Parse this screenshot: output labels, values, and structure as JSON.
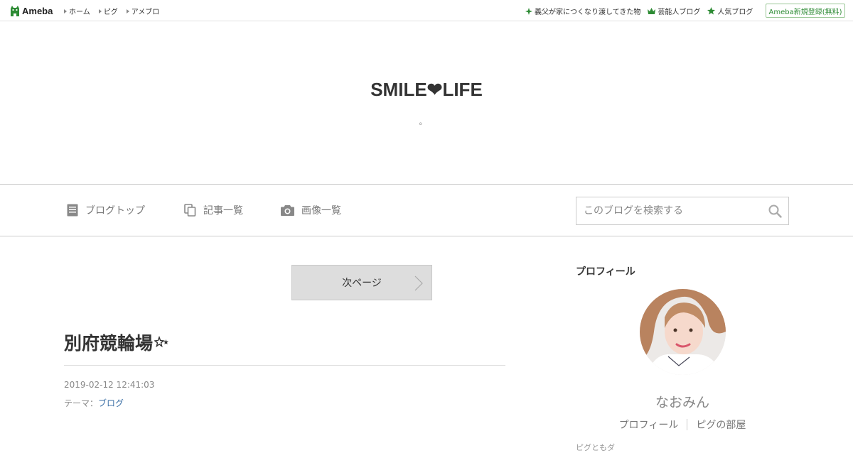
{
  "topbar": {
    "logo_text": "Ameba",
    "nav": [
      {
        "label": "ホーム"
      },
      {
        "label": "ピグ"
      },
      {
        "label": "アメブロ"
      }
    ],
    "links": [
      {
        "label": "義父が家につくなり渡してきた物",
        "icon": "sparkle-icon"
      },
      {
        "label": "芸能人ブログ",
        "icon": "crown-icon"
      },
      {
        "label": "人気ブログ",
        "icon": "star-icon"
      }
    ],
    "signup_label": "Ameba新規登録(無料)",
    "brand_color": "#2d8b34"
  },
  "blog": {
    "title": "SMILE❤LIFE",
    "description": "。"
  },
  "blognav": {
    "items": [
      {
        "label": "ブログトップ",
        "icon": "document-icon"
      },
      {
        "label": "記事一覧",
        "icon": "copy-icon"
      },
      {
        "label": "画像一覧",
        "icon": "camera-icon"
      }
    ],
    "search_placeholder": "このブログを検索する"
  },
  "main": {
    "next_page_label": "次ページ",
    "entry": {
      "title": "別府競輪場",
      "date": "2019-02-12 12:41:03",
      "theme_label": "テーマ：",
      "theme_link": "ブログ"
    }
  },
  "sidebar": {
    "heading": "プロフィール",
    "name": "なおみん",
    "links": [
      {
        "label": "プロフィール"
      },
      {
        "label": "ピグの部屋"
      }
    ],
    "more_label": "ピグともダ"
  }
}
